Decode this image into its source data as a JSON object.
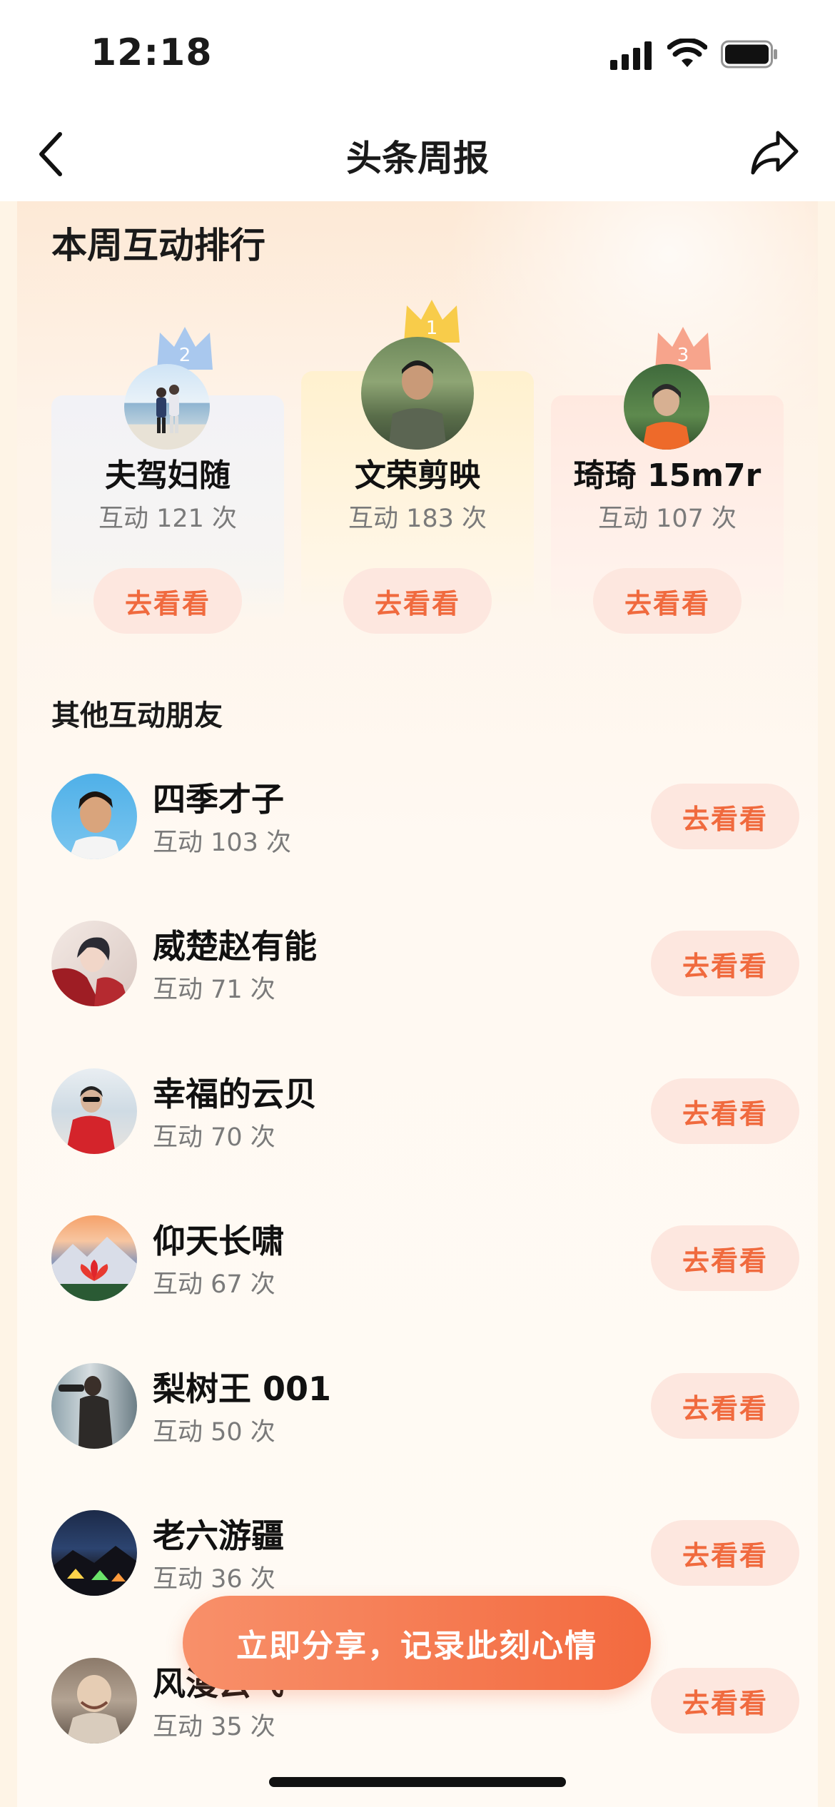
{
  "status": {
    "time": "12:18"
  },
  "nav": {
    "title": "头条周报"
  },
  "ranking": {
    "title": "本周互动排行",
    "top": [
      {
        "rank": "2",
        "name": "夫驾妇随",
        "count": "互动 121 次",
        "button": "去看看"
      },
      {
        "rank": "1",
        "name": "文荣剪映",
        "count": "互动 183 次",
        "button": "去看看"
      },
      {
        "rank": "3",
        "name": "琦琦 15m7r",
        "count": "互动 107 次",
        "button": "去看看"
      }
    ]
  },
  "others": {
    "title": "其他互动朋友",
    "items": [
      {
        "name": "四季才子",
        "count": "互动 103 次",
        "button": "去看看"
      },
      {
        "name": "威楚赵有能",
        "count": "互动 71 次",
        "button": "去看看"
      },
      {
        "name": "幸福的云贝",
        "count": "互动 70 次",
        "button": "去看看"
      },
      {
        "name": "仰天长啸",
        "count": "互动 67 次",
        "button": "去看看"
      },
      {
        "name": "梨树王 001",
        "count": "互动 50 次",
        "button": "去看看"
      },
      {
        "name": "老六游疆",
        "count": "互动 36 次",
        "button": "去看看"
      },
      {
        "name": "风漫云飞",
        "count": "互动 35 次",
        "button": "去看看"
      }
    ]
  },
  "cta": {
    "label": "立即分享，记录此刻心情"
  },
  "colors": {
    "accent": "#f06a3e",
    "button_bg": "#fde7df",
    "gold": "#f8cc4a",
    "silver": "#a9c8ee",
    "bronze": "#f7a48c"
  },
  "icons": {
    "back": "chevron-left-icon",
    "share": "share-arrow-icon"
  }
}
